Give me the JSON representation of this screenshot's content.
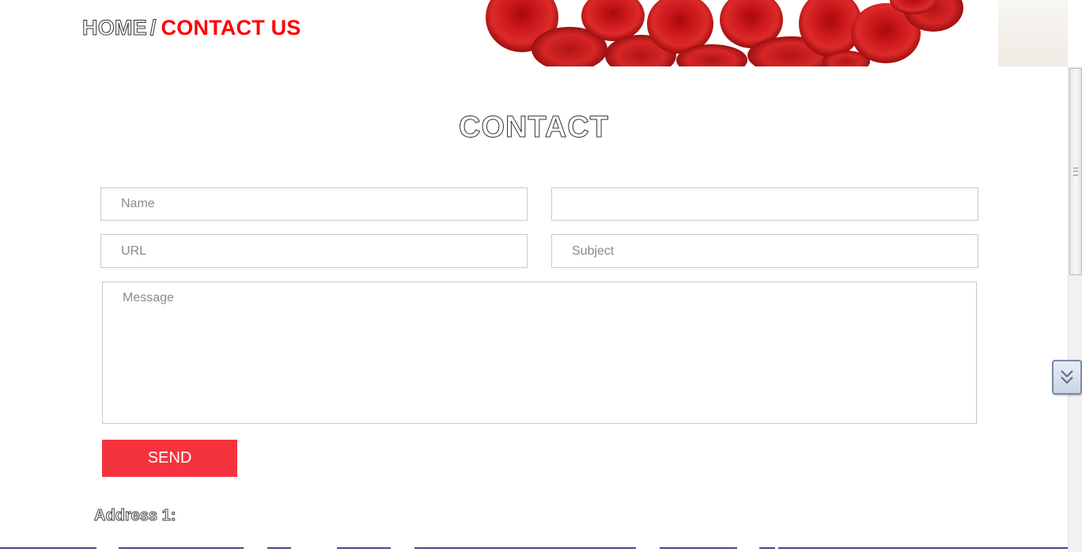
{
  "breadcrumb": {
    "home": "HOME",
    "separator": "/",
    "current": "CONTACT US"
  },
  "banner": {
    "icon": "red-blood-cells-image"
  },
  "section": {
    "title": "CONTACT"
  },
  "form": {
    "name_placeholder": "Name",
    "email_placeholder": "",
    "url_placeholder": "URL",
    "subject_placeholder": "Subject",
    "message_placeholder": "Message",
    "send_label": "SEND"
  },
  "address": {
    "label": "Address 1:"
  },
  "colors": {
    "accent": "#ff0000",
    "button": "#f5333f"
  }
}
